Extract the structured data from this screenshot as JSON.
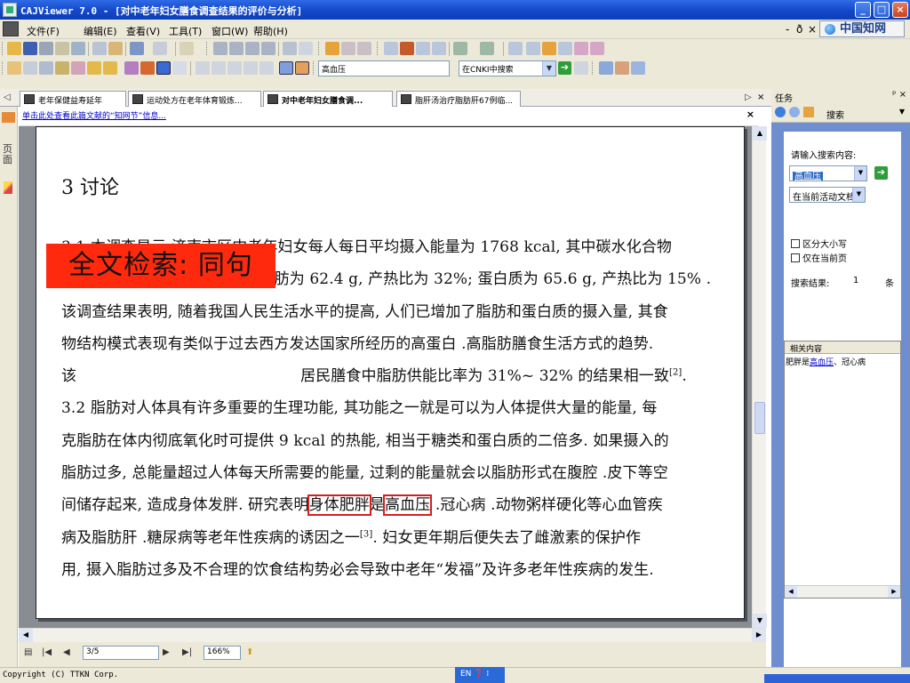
{
  "window": {
    "title": "CAJViewer 7.0 - [对中老年妇女膳食调查结果的评价与分析]",
    "controls": {
      "minimize": "_",
      "maximize": "□",
      "close": "×"
    }
  },
  "menu": {
    "items": [
      "文件(F)",
      "编辑(E)",
      "查看(V)",
      "工具(T)",
      "窗口(W)",
      "帮助(H)"
    ],
    "mdi_controls": [
      "-",
      "ð",
      "×"
    ],
    "cnki_label": "中国知网"
  },
  "toolbar": {
    "search_term": "高血压",
    "search_scope": "在CNKI中搜索"
  },
  "tabs": {
    "items": [
      {
        "label": "老年保健益寿延年",
        "active": false
      },
      {
        "label": "运动处方在老年体育锻炼...",
        "active": false
      },
      {
        "label": "对中老年妇女膳食调...",
        "active": true
      },
      {
        "label": "脂肝汤治疗脂肪肝67例临...",
        "active": false
      }
    ],
    "nav_left": "◁",
    "nav_right": "▷",
    "close": "×"
  },
  "left_strip": {
    "bookmark_tab_label": "页面"
  },
  "info_bar": {
    "link_text": "单击此处查看此篇文献的“知网节”信息...",
    "close": "×"
  },
  "document": {
    "heading": "3  讨论",
    "lines": [
      "3.1  本调查显示,济南市区中老年妇女每人每日平均摄入能量为 1768 kcal, 其中碳水化合物",
      "为 236.1 g, 产热比为 53%; 脂肪为 62.4 g, 产热比为 32%; 蛋白质为 65.6 g, 产热比为 15% .",
      "该调查结果表明, 随着我国人民生活水平的提高, 人们已增加了脂肪和蛋白质的摄入量, 其食",
      "物结构模式表现有类似于过去西方发达国家所经历的高蛋白 .高脂肪膳食生活方式的趋势.",
      "该",
      "3.2  脂肪对人体具有许多重要的生理功能, 其功能之一就是可以为人体提供大量的能量, 每",
      "克脂肪在体内彻底氧化时可提供 9 kcal 的热能, 相当于糖类和蛋白质的二倍多. 如果摄入的",
      "脂肪过多, 总能量超过人体每天所需要的能量, 过剩的能量就会以脂肪形式在腹腔 .皮下等空",
      "间储存起来, 造成身体发胖. 研究表明",
      "病及脂肪肝 .糖尿病等老年性疾病的诱因之一",
      "用, 摄入脂肪过多及不合理的饮食结构势必会导致中老年“发福”及许多老年性疾病的发生."
    ],
    "line5_tail": "居民膳食中脂肪供能比率为 31%~ 32% 的结果相一致",
    "ref2": "[2]",
    "line9_hl1": "身体肥胖",
    "line9_mid": "是",
    "line9_hl2": "高血压",
    "line9_tail": " .冠心病 .动物粥样硬化等心血管疾",
    "ref3": "[3]",
    "line10_tail": ". 妇女更年期后便失去了雌激素的保护作"
  },
  "overlay_banner": "全文检索: 同句",
  "navigation": {
    "page": "3/5",
    "zoom": "166%"
  },
  "task_pane": {
    "title": "任务",
    "pin": "ᵖ ×",
    "section": "搜索",
    "search_label": "请输入搜索内容:",
    "query": "高血压",
    "scope": "在当前活动文档",
    "options": [
      "区分大小写",
      "仅在当前页"
    ],
    "results_label": "搜索结果:",
    "results_count": "1",
    "results_unit": "条",
    "related": {
      "header": "相关内容",
      "item_prefix": "肥胖是",
      "item_link": "高血压",
      "item_suffix": "、冠心病"
    }
  },
  "status": {
    "copyright": "Copyright (C) TTKN Corp.",
    "ime": "EN"
  }
}
